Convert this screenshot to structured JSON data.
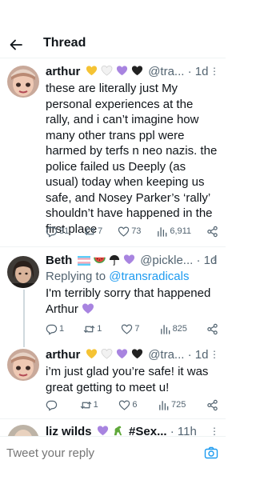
{
  "header": {
    "title": "Thread"
  },
  "tweets": [
    {
      "name": "arthur",
      "emojis": [
        "yellow-heart",
        "white-heart",
        "purple-heart",
        "black-heart"
      ],
      "handle": "@tra...",
      "dot": "·",
      "time": "1d",
      "text": "these are literally just My personal experiences at the rally, and i can’t imagine how many other trans ppl were harmed by terfs n neo nazis. the police failed us Deeply (as usual) today when keeping us safe, and Nosey Parker’s ‘rally’ shouldn’t have happened in the first place",
      "stats": {
        "replies": "31",
        "retweets": "7",
        "likes": "73",
        "views": "6,911"
      }
    },
    {
      "name": "Beth",
      "emojis": [
        "transgender-flag",
        "watermelon",
        "umbrella",
        "purple-heart"
      ],
      "handle": "@pickle...",
      "dot": "·",
      "time": "1d",
      "reply_prefix": "Replying to",
      "reply_mention": "@transradicals",
      "text": "I'm terribly sorry that happened Arthur",
      "text_emoji": "purple-heart",
      "stats": {
        "replies": "1",
        "retweets": "1",
        "likes": "7",
        "views": "825"
      }
    },
    {
      "name": "arthur",
      "emojis": [
        "yellow-heart",
        "white-heart",
        "purple-heart",
        "black-heart"
      ],
      "handle": "@tra...",
      "dot": "·",
      "time": "1d",
      "text": "i’m just glad you’re safe! it was great getting to meet u!",
      "stats": {
        "replies": "",
        "retweets": "1",
        "likes": "6",
        "views": "725"
      }
    },
    {
      "name": "liz wilds",
      "emojis": [
        "purple-heart",
        "dinosaur"
      ],
      "handle": "#Sex...",
      "dot": "·",
      "time": "11h"
    }
  ],
  "compose": {
    "placeholder": "Tweet your reply"
  },
  "colors": {
    "accent": "#1d9bf0",
    "secondary_text": "#536471",
    "divider": "#eff3f4"
  },
  "icons": [
    "back-arrow-icon",
    "more-icon",
    "reply-icon",
    "retweet-icon",
    "like-icon",
    "views-icon",
    "share-icon",
    "camera-icon"
  ]
}
